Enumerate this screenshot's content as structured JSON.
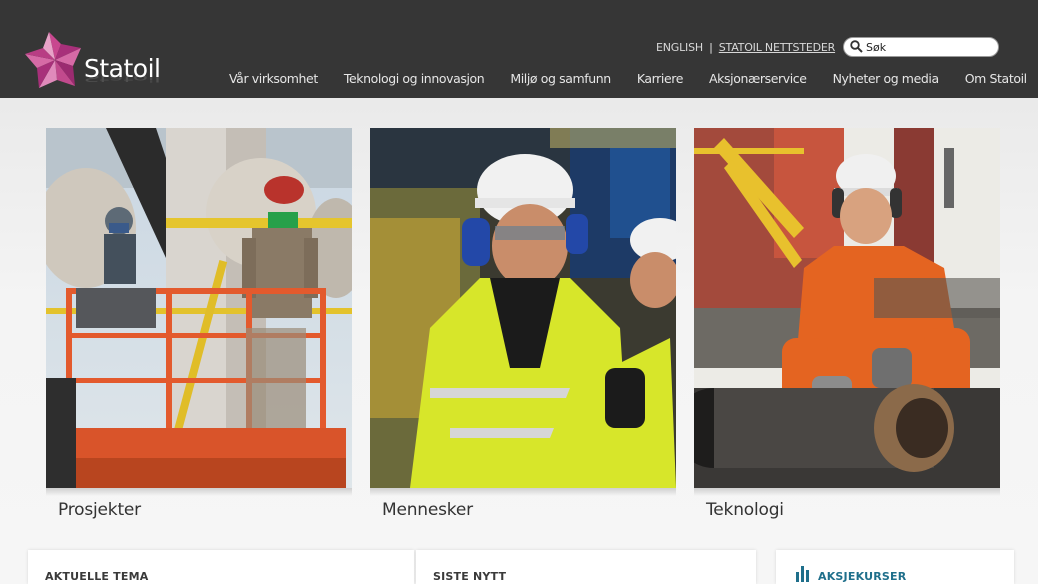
{
  "brand": {
    "name": "Statoil"
  },
  "toplinks": {
    "english": "ENGLISH",
    "sep": "|",
    "sites": "STATOIL NETTSTEDER"
  },
  "search": {
    "value": "Søk"
  },
  "nav": {
    "items": [
      "Vår virksomhet",
      "Teknologi og innovasjon",
      "Miljø og samfunn",
      "Karriere",
      "Aksjonærservice",
      "Nyheter og media",
      "Om Statoil"
    ]
  },
  "features": [
    {
      "label": "Prosjekter"
    },
    {
      "label": "Mennesker"
    },
    {
      "label": "Teknologi"
    }
  ],
  "panels": {
    "current": "AKTUELLE TEMA",
    "news": "SISTE NYTT",
    "stock": "AKSJEKURSER"
  },
  "colors": {
    "header_bg": "#363636",
    "accent_pink": "#b0307a",
    "stock_blue": "#1f6f8b"
  },
  "icons": [
    "search-icon",
    "statoil-star-logo",
    "bar-chart-icon"
  ]
}
